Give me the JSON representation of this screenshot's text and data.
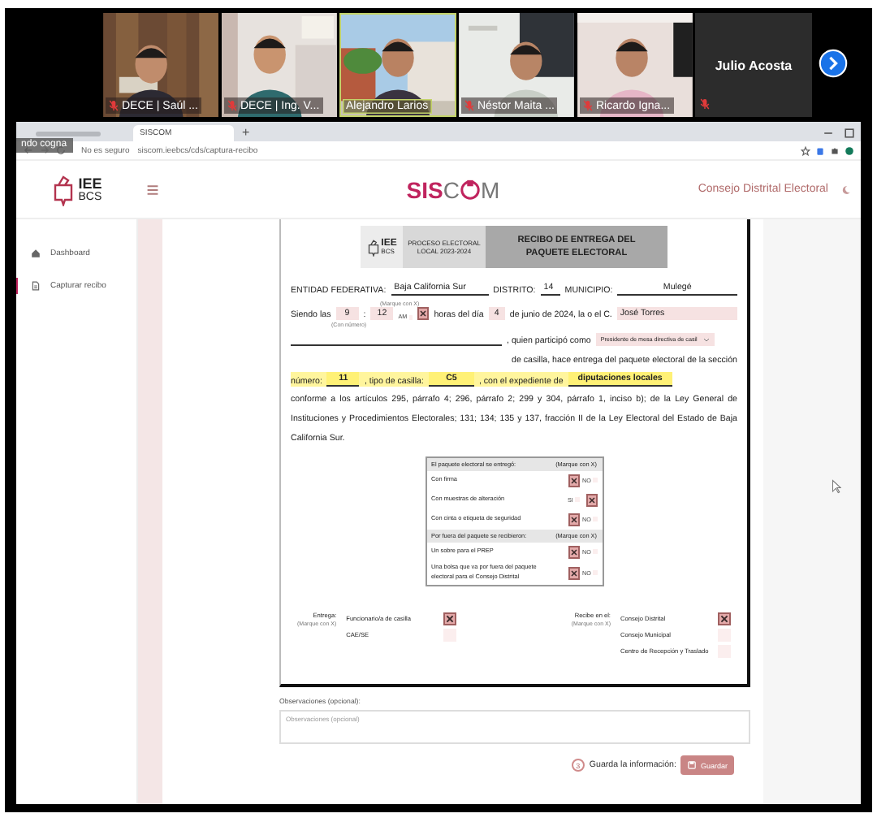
{
  "call": {
    "participants": [
      {
        "name": "DECE | Saúl ...",
        "muted": true,
        "speaking": false
      },
      {
        "name": "DECE | Ing. V...",
        "muted": true,
        "speaking": false
      },
      {
        "name": "Alejandro Larios",
        "muted": false,
        "speaking": true
      },
      {
        "name": "Néstor Maita ...",
        "muted": true,
        "speaking": false
      },
      {
        "name": "Ricardo Igna...",
        "muted": true,
        "speaking": false
      }
    ],
    "featured": {
      "name": "Julio Acosta",
      "muted": true
    },
    "overlay_label": "ndo cogna"
  },
  "browser": {
    "tabs": [
      {
        "selected": false
      },
      {
        "label": "SISCOM",
        "selected": true
      }
    ],
    "new_tab": "+",
    "security": "No es seguro",
    "url": "siscom.ieebcs/cds/captura-recibo"
  },
  "app": {
    "logo_top": "IEE",
    "logo_bottom": "BCS",
    "brand_prefix": "SIS",
    "brand_c": "C",
    "brand_m": "M",
    "office": "Consejo Distrital Electoral",
    "sidebar": [
      {
        "label": "Dashboard",
        "kind": "home",
        "selected": false
      },
      {
        "label": "Capturar recibo",
        "kind": "document",
        "selected": true
      }
    ]
  },
  "form": {
    "logo_top": "IEE",
    "logo_bottom": "BCS",
    "process": "PROCESO ELECTORAL LOCAL 2023-2024",
    "title": "RECIBO DE ENTREGA DEL PAQUETE ELECTORAL",
    "entidad_label": "ENTIDAD FEDERATIVA:",
    "entidad": "Baja California Sur",
    "distrito_label": "DISTRITO:",
    "distrito": "14",
    "municipio_label": "MUNICIPIO:",
    "municipio": "Mulegé",
    "mark_hint": "(Marque con X)",
    "siendo": "Siendo las",
    "hour": "9",
    "colon": ":",
    "minute": "12",
    "number_hint": "(Con número)",
    "meridiem": [
      {
        "label": "AM",
        "checked": false
      },
      {
        "checked": true
      }
    ],
    "horas": "horas del día",
    "day": "4",
    "date_text": "de junio de 2024, la o el C.",
    "person": "José Torres",
    "participo": ", quien participó como",
    "role": "Presidente de mesa directiva de casil",
    "entrega_text": "de casilla, hace entrega del paquete electoral de la sección",
    "numero_label": "número:",
    "numero": "11",
    "tipo_label": ", tipo de casilla:",
    "tipo": "C5",
    "expediente_label": ", con el expediente de",
    "expediente": "diputaciones locales",
    "legal": "conforme a los artículos 295, párrafo 4; 296, párrafo 2; 299 y 304, párrafo 1, inciso b); de la Ley General de Instituciones y Procedimientos Electorales; 131; 134; 135 y 137, fracción II de la Ley Electoral del Estado de Baja California Sur.",
    "checklist": [
      {
        "title": "El paquete electoral se entregó:",
        "hint": "(Marque con X)",
        "rows": [
          {
            "label": "Con firma",
            "options": [
              {
                "checked": true
              },
              {
                "label": "NO",
                "checked": false
              }
            ]
          },
          {
            "label": "Con muestras de alteración",
            "options": [
              {
                "label": "SI",
                "checked": false
              },
              {
                "checked": true
              }
            ]
          },
          {
            "label": "Con cinta o etiqueta de seguridad",
            "options": [
              {
                "checked": true
              },
              {
                "label": "NO",
                "checked": false
              }
            ]
          }
        ]
      },
      {
        "title": "Por fuera del paquete se recibieron:",
        "hint": "(Marque con X)",
        "rows": [
          {
            "label": "Un sobre para el PREP",
            "options": [
              {
                "checked": true
              },
              {
                "label": "NO",
                "checked": false
              }
            ]
          },
          {
            "label": "Una bolsa que va por fuera del paquete electoral para el Consejo Distrital",
            "options": [
              {
                "checked": true
              },
              {
                "label": "NO",
                "checked": false
              }
            ]
          }
        ]
      }
    ],
    "handover": [
      {
        "label": "Entrega:",
        "hint": "(Marque con X)",
        "options": [
          {
            "label": "Funcionario/a de casilla",
            "checked": true
          },
          {
            "label": "CAE/SE",
            "checked": false
          }
        ]
      },
      {
        "label": "Recibe en el:",
        "hint": "(Marque con X)",
        "options": [
          {
            "label": "Consejo Distrital",
            "checked": true
          },
          {
            "label": "Consejo Municipal",
            "checked": false
          },
          {
            "label": "Centro de Recepción y Traslado",
            "checked": false
          }
        ]
      }
    ],
    "notes_label": "Observaciones (opcional):",
    "notes_placeholder": "Observaciones (opcional)",
    "step": "3",
    "save_hint": "Guarda la información:",
    "save_button": "Guardar"
  }
}
